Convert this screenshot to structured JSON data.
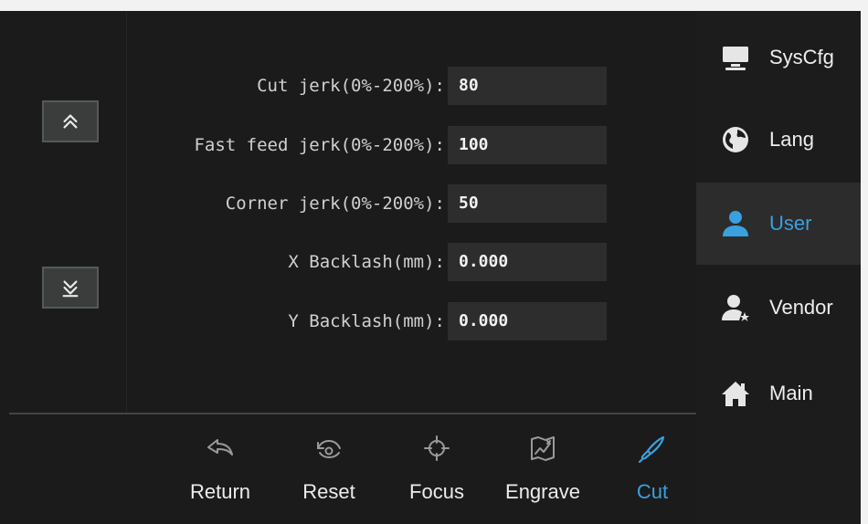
{
  "scroll": {
    "up_icon": "chevron-double-up-icon",
    "down_icon": "chevron-double-down-icon"
  },
  "settings": [
    {
      "label": "Cut jerk(0%-200%):",
      "value": "80"
    },
    {
      "label": "Fast feed jerk(0%-200%):",
      "value": "100"
    },
    {
      "label": "Corner jerk(0%-200%):",
      "value": "50"
    },
    {
      "label": "X Backlash(mm):",
      "value": "0.000"
    },
    {
      "label": "Y Backlash(mm):",
      "value": "0.000"
    }
  ],
  "toolbar": [
    {
      "label": "Return",
      "icon": "return-arrow-icon"
    },
    {
      "label": "Reset",
      "icon": "reset-icon"
    },
    {
      "label": "Focus",
      "icon": "crosshair-icon"
    },
    {
      "label": "Engrave",
      "icon": "engrave-icon"
    },
    {
      "label": "Cut",
      "icon": "pen-nib-icon",
      "active": true
    }
  ],
  "sidebar": [
    {
      "label": "SysCfg",
      "icon": "monitor-icon"
    },
    {
      "label": "Lang",
      "icon": "globe-icon"
    },
    {
      "label": "User",
      "icon": "user-icon",
      "active": true
    },
    {
      "label": "Vendor",
      "icon": "vendor-user-icon"
    },
    {
      "label": "Main",
      "icon": "home-icon"
    }
  ],
  "colors": {
    "accent": "#3aa0e0",
    "background": "#1e1e1e",
    "field": "#2d2d2d",
    "text": "#d0d0d0"
  }
}
